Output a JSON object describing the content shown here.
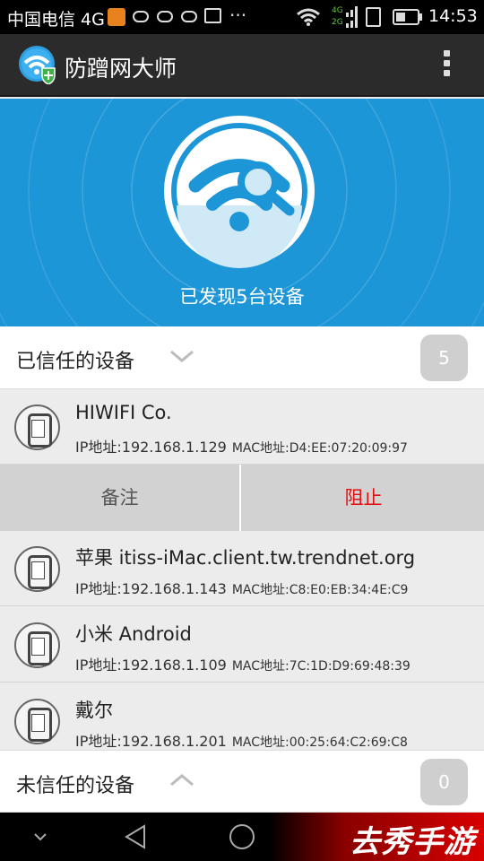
{
  "status_bar": {
    "carrier": "中国电信 4G",
    "time": "14:53",
    "icons": [
      "app-notification-icon",
      "cloud-icon",
      "cloud-icon",
      "cloud-icon",
      "image-icon",
      "more-dots-icon",
      "wifi-icon",
      "signal-4g-2g-icon",
      "sim-icon",
      "battery-icon"
    ],
    "signal_labels": [
      "4G",
      "2G"
    ]
  },
  "app_bar": {
    "title": "防蹭网大师",
    "logo_icon": "wifi-shield-logo-icon",
    "menu_icon": "overflow-menu-icon"
  },
  "hero": {
    "found_text": "已发现5台设备",
    "icon": "wifi-search-icon"
  },
  "trusted": {
    "label": "已信任的设备",
    "count": "5",
    "expanded": true
  },
  "devices": [
    {
      "name": "HIWIFI Co.",
      "ip_label": "IP地址:",
      "ip": "192.168.1.129",
      "mac_label": "MAC地址:",
      "mac": "D4:EE:07:20:09:97"
    },
    {
      "name": "苹果 itiss-iMac.client.tw.trendnet.org",
      "ip_label": "IP地址:",
      "ip": "192.168.1.143",
      "mac_label": "MAC地址:",
      "mac": "C8:E0:EB:34:4E:C9"
    },
    {
      "name": "小米 Android",
      "ip_label": "IP地址:",
      "ip": "192.168.1.109",
      "mac_label": "MAC地址:",
      "mac": "7C:1D:D9:69:48:39"
    },
    {
      "name": "戴尔",
      "ip_label": "IP地址:",
      "ip": "192.168.1.201",
      "mac_label": "MAC地址:",
      "mac": "00:25:64:C2:69:C8"
    }
  ],
  "actions": {
    "note_label": "备注",
    "block_label": "阻止"
  },
  "untrusted": {
    "label": "未信任的设备",
    "count": "0",
    "expanded": false
  },
  "nav_bar": {
    "buttons": [
      "hide-keyboard-icon",
      "back-icon",
      "home-icon"
    ],
    "watermark": "去秀手游"
  },
  "colors": {
    "hero_blue": "#1d96d8",
    "app_bar": "#2b2b2b",
    "block_red": "#e01010",
    "badge_gray": "#cfcfcf"
  }
}
